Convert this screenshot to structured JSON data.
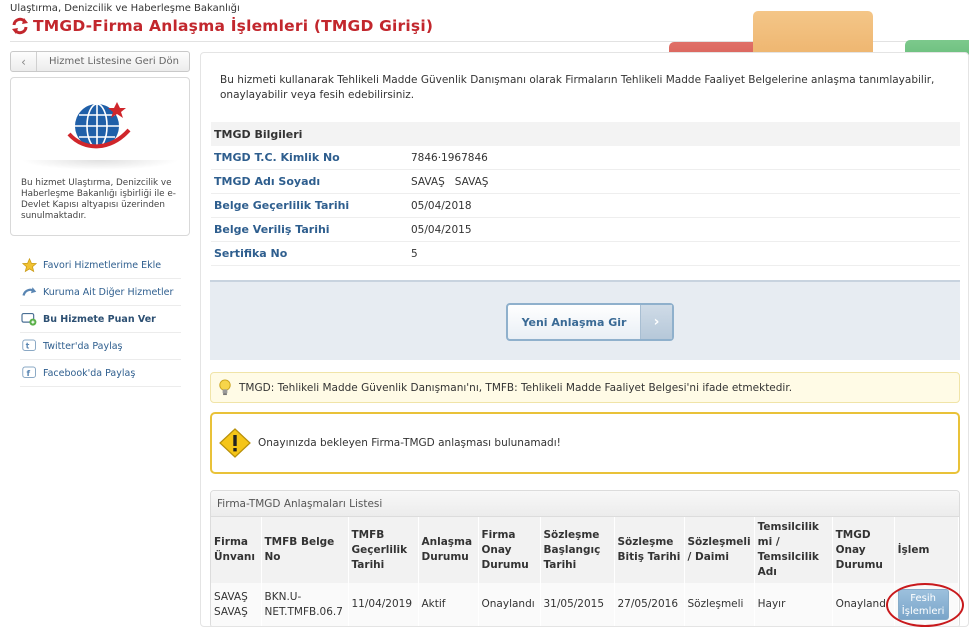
{
  "header": {
    "org": "Ulaştırma, Denizcilik ve Haberleşme Bakanlığı",
    "title": "TMGD-Firma Anlaşma İşlemleri (TMGD Girişi)"
  },
  "sidebar": {
    "back_label": "Hizmet Listesine Geri Dön",
    "org_desc": "Bu hizmet Ulaştırma, Denizcilik ve Haberleşme Bakanlığı işbirliği ile e-Devlet Kapısı altyapısı üzerinden sunulmaktadır.",
    "items": [
      {
        "label": "Favori Hizmetlerime Ekle",
        "icon": "star-icon"
      },
      {
        "label": "Kuruma Ait Diğer Hizmetler",
        "icon": "redirect-icon"
      },
      {
        "label": "Bu Hizmete Puan Ver",
        "icon": "rating-icon"
      },
      {
        "label": "Twitter'da Paylaş",
        "icon": "twitter-icon"
      },
      {
        "label": "Facebook'da Paylaş",
        "icon": "facebook-icon"
      }
    ]
  },
  "main": {
    "intro": "Bu hizmeti kullanarak Tehlikeli Madde Güvenlik Danışmanı olarak Firmaların Tehlikeli Madde Faaliyet Belgelerine anlaşma tanımlayabilir, onaylayabilir veya fesih edebilirsiniz.",
    "info_title": "TMGD Bilgileri",
    "info_rows": [
      {
        "label": "TMGD T.C. Kimlik No",
        "value": "7846·1967846"
      },
      {
        "label": "TMGD Adı Soyadı",
        "value": "SAVAŞ   SAVAŞ"
      },
      {
        "label": "Belge Geçerlilik Tarihi",
        "value": "05/04/2018"
      },
      {
        "label": "Belge Veriliş Tarihi",
        "value": "05/04/2015"
      },
      {
        "label": "Sertifika No",
        "value": "5"
      }
    ],
    "new_button": "Yeni Anlaşma Gir",
    "tip": "TMGD: Tehlikeli Madde Güvenlik Danışmanı'nı, TMFB: Tehlikeli Madde Faaliyet Belgesi'ni ifade etmektedir.",
    "warning": "Onayınızda bekleyen Firma-TMGD anlaşması bulunamadı!",
    "list_title": "Firma-TMGD Anlaşmaları Listesi",
    "columns": [
      "Firma Ünvanı",
      "TMFB Belge No",
      "TMFB Geçerlilik Tarihi",
      "Anlaşma Durumu",
      "Firma Onay Durumu",
      "Sözleşme Başlangıç Tarihi",
      "Sözleşme Bitiş Tarihi",
      "Sözleşmeli / Daimi",
      "Temsilcilik mi / Temsilcilik Adı",
      "TMGD Onay Durumu",
      "İşlem"
    ],
    "rows": [
      {
        "firma": "SAVAŞ SAVAŞ",
        "belge_no": "BKN.U-NET.TMFB.06.7",
        "gecerlilik": "11/04/2019",
        "anlasma": "Aktif",
        "firma_onay": "Onaylandı",
        "baslangic": "31/05/2015",
        "bitis": "27/05/2016",
        "sozlesme_tipi": "Sözleşmeli",
        "temsilcilik": "Hayır",
        "tmgd_onay": "Onaylandı",
        "action": "Fesih İşlemleri"
      }
    ]
  },
  "colors": {
    "title_red": "#c2272d",
    "link_blue": "#2e5e8e",
    "highlight_circle": "#c8191c",
    "warning_border": "#e9c239"
  }
}
